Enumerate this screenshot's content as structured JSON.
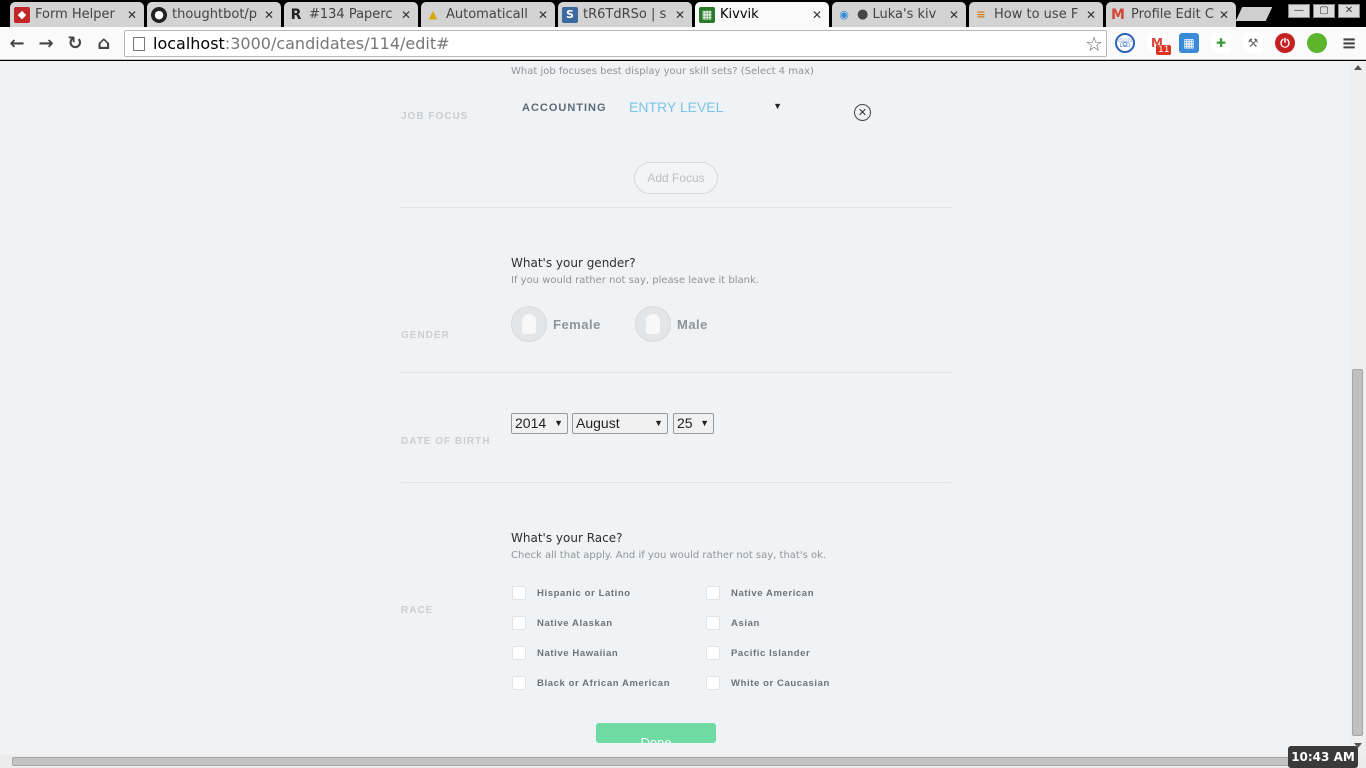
{
  "browser": {
    "tabs": [
      {
        "title": "Form Helper",
        "icon": "ruby-icon",
        "color": "#c0262a"
      },
      {
        "title": "thoughtbot/p",
        "icon": "github-icon",
        "color": "#222222"
      },
      {
        "title": "#134 Paperc",
        "icon": "railscasts-icon",
        "color": "#333333"
      },
      {
        "title": "Automaticall",
        "icon": "construction-icon",
        "color": "#e5b700"
      },
      {
        "title": "tR6TdRSo | s",
        "icon": "s-icon",
        "color": "#3b6aa0"
      },
      {
        "title": "Kivvik",
        "icon": "kivvik-icon",
        "color": "#2a7a2a",
        "active": true
      },
      {
        "title": "● Luka's kiv",
        "icon": "chat-icon",
        "color": "#2e8bd8"
      },
      {
        "title": "How to use F",
        "icon": "stack-icon",
        "color": "#d97a1e"
      },
      {
        "title": "Profile Edit C",
        "icon": "gmail-icon",
        "color": "#d44638"
      }
    ],
    "url_host": "localhost",
    "url_path": ":3000/candidates/114/edit#",
    "ext_badge": "11",
    "clock": "10:43 AM"
  },
  "form": {
    "job_focus": {
      "label": "JOB FOCUS",
      "hint": "What job focuses best display your skill sets? (Select 4 max)",
      "focus_name": "ACCOUNTING",
      "focus_level": "ENTRY LEVEL",
      "add_label": "Add Focus"
    },
    "gender": {
      "label": "GENDER",
      "question": "What's your gender?",
      "hint": "If you would rather not say, please leave it blank.",
      "options": [
        "Female",
        "Male"
      ]
    },
    "dob": {
      "label": "DATE OF BIRTH",
      "year": "2014",
      "month": "August",
      "day": "25"
    },
    "race": {
      "label": "RACE",
      "question": "What's your Race?",
      "hint": "Check all that apply. And if you would rather not say, that's ok.",
      "options_left": [
        "Hispanic or Latino",
        "Native Alaskan",
        "Native Hawaiian",
        "Black or African American"
      ],
      "options_right": [
        "Native American",
        "Asian",
        "Pacific Islander",
        "White or Caucasian"
      ]
    },
    "done_label": "Done"
  }
}
